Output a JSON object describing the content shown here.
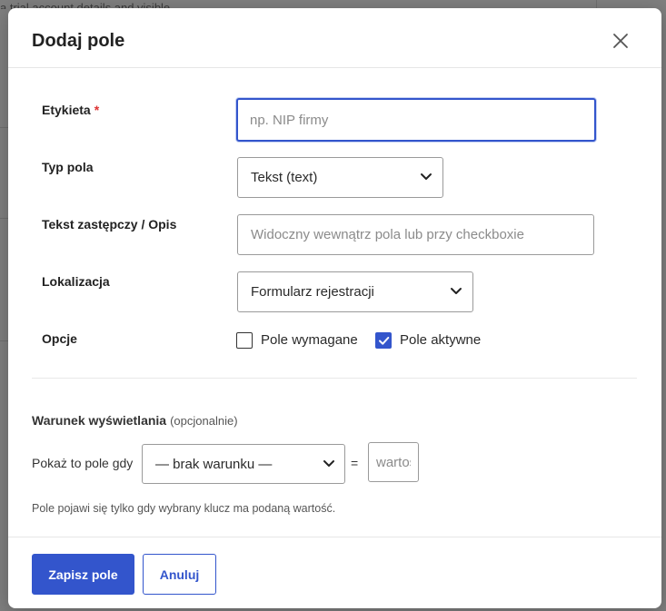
{
  "backdrop": {
    "text": "a trial account details and visible"
  },
  "modal": {
    "title": "Dodaj pole",
    "close_icon": "close-icon"
  },
  "form": {
    "label": {
      "label": "Etykieta",
      "required_mark": "*",
      "value": "",
      "placeholder": "np. NIP firmy"
    },
    "field_type": {
      "label": "Typ pola",
      "selected": "Tekst (text)"
    },
    "placeholder_text": {
      "label": "Tekst zastępczy / Opis",
      "value": "",
      "placeholder": "Widoczny wewnątrz pola lub przy checkboxie"
    },
    "location": {
      "label": "Lokalizacja",
      "selected": "Formularz rejestracji"
    },
    "options": {
      "label": "Opcje",
      "required_label": "Pole wymagane",
      "required_checked": false,
      "active_label": "Pole aktywne",
      "active_checked": true
    }
  },
  "condition": {
    "title": "Warunek wyświetlania",
    "title_suffix": "(opcjonalnie)",
    "show_when_label": "Pokaż to pole gdy",
    "condition_selected": "— brak warunku —",
    "equals": "=",
    "value_placeholder": "wartość",
    "hint": "Pole pojawi się tylko gdy wybrany klucz ma podaną wartość."
  },
  "footer": {
    "save_label": "Zapisz pole",
    "cancel_label": "Anuluj"
  },
  "colors": {
    "accent": "#3355cc",
    "required": "#dd3333",
    "backdrop": "#7f7f7f"
  }
}
